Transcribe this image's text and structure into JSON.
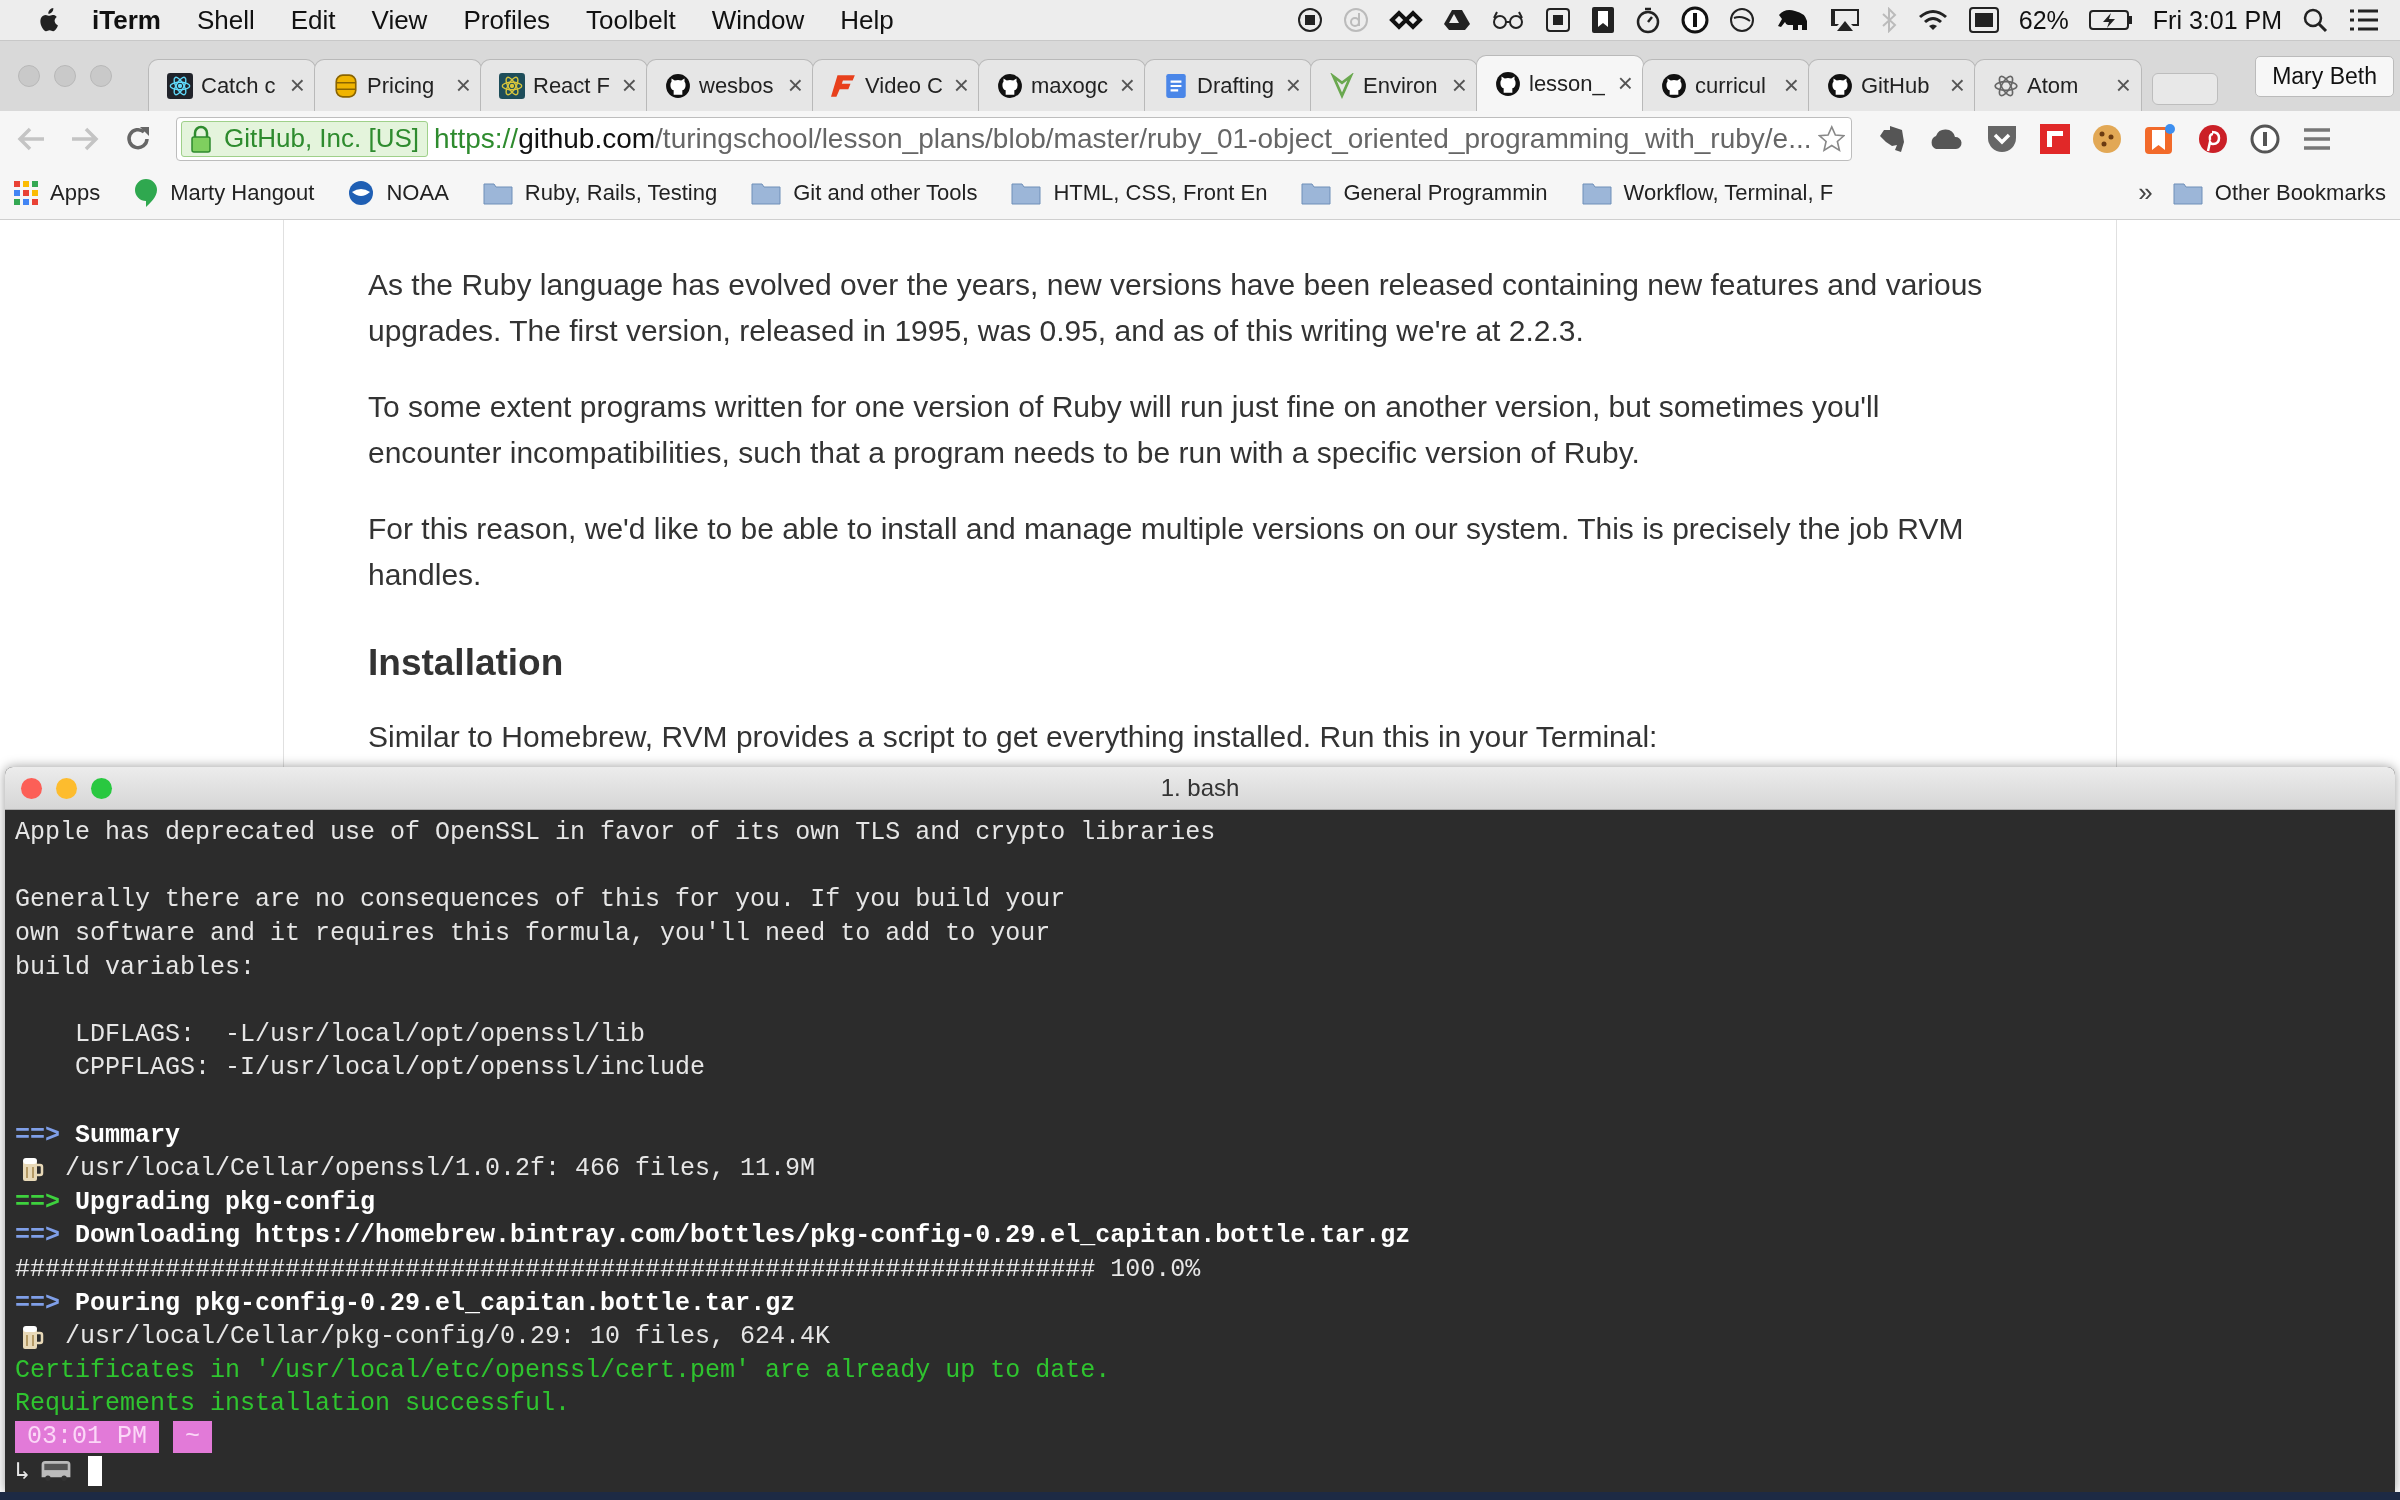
{
  "menubar": {
    "app": "iTerm",
    "menus": [
      "Shell",
      "Edit",
      "View",
      "Profiles",
      "Toolbelt",
      "Window",
      "Help"
    ],
    "battery": "62%",
    "clock": "Fri 3:01 PM"
  },
  "browser": {
    "tabs": [
      {
        "label": "Catch c",
        "selected": false
      },
      {
        "label": "Pricing",
        "selected": false
      },
      {
        "label": "React F",
        "selected": false
      },
      {
        "label": "wesbos",
        "selected": false
      },
      {
        "label": "Video C",
        "selected": false
      },
      {
        "label": "maxogc",
        "selected": false
      },
      {
        "label": "Drafting",
        "selected": false
      },
      {
        "label": "Environ",
        "selected": false
      },
      {
        "label": "lesson_",
        "selected": true
      },
      {
        "label": "curricul",
        "selected": false
      },
      {
        "label": "GitHub",
        "selected": false
      },
      {
        "label": "Atom",
        "selected": false
      }
    ],
    "tab_close": "×",
    "profile": "Mary Beth",
    "address": {
      "identity": "GitHub, Inc. [US]",
      "scheme": "https://",
      "host": "github.com",
      "path": "/turingschool/lesson_plans/blob/master/ruby_01-object_oriented_programming_with_ruby/e..."
    },
    "bookmarks": [
      {
        "kind": "apps",
        "label": "Apps"
      },
      {
        "kind": "hangout",
        "label": "Marty Hangout"
      },
      {
        "kind": "noaa",
        "label": "NOAA"
      },
      {
        "kind": "folder",
        "label": "Ruby, Rails, Testing"
      },
      {
        "kind": "folder",
        "label": "Git and other Tools"
      },
      {
        "kind": "folder",
        "label": "HTML, CSS, Front En"
      },
      {
        "kind": "folder",
        "label": "General Programmin"
      },
      {
        "kind": "folder",
        "label": "Workflow, Terminal, F"
      }
    ],
    "bookmarks_more": "»",
    "other_bookmarks": "Other Bookmarks"
  },
  "page": [
    {
      "kind": "paragraph",
      "text": "As the Ruby language has evolved over the years, new versions have been released containing new features and various upgrades. The first version, released in 1995, was 0.95, and as of this writing we're at 2.2.3."
    },
    {
      "kind": "paragraph",
      "text": "To some extent programs written for one version of Ruby will run just fine on another version, but sometimes you'll encounter incompatibilities, such that a program needs to be run with a specific version of Ruby."
    },
    {
      "kind": "paragraph",
      "text": "For this reason, we'd like to be able to install and manage multiple versions on our system. This is precisely the job RVM handles."
    },
    {
      "kind": "heading",
      "text": "Installation"
    },
    {
      "kind": "paragraph",
      "text": "Similar to Homebrew, RVM provides a script to get everything installed. Run this in your Terminal:"
    }
  ],
  "terminal": {
    "title": "1. bash",
    "lines": [
      {
        "kind": "plain",
        "text": "Apple has deprecated use of OpenSSL in favor of its own TLS and crypto libraries"
      },
      {
        "kind": "blank"
      },
      {
        "kind": "plain",
        "text": "Generally there are no consequences of this for you. If you build your"
      },
      {
        "kind": "plain",
        "text": "own software and it requires this formula, you'll need to add to your"
      },
      {
        "kind": "plain",
        "text": "build variables:"
      },
      {
        "kind": "blank"
      },
      {
        "kind": "plain",
        "text": "    LDFLAGS:  -L/usr/local/opt/openssl/lib"
      },
      {
        "kind": "plain",
        "text": "    CPPFLAGS: -I/usr/local/opt/openssl/include"
      },
      {
        "kind": "blank"
      },
      {
        "kind": "step",
        "marker": "==>",
        "color": "#7f9fe8",
        "text": "Summary"
      },
      {
        "kind": "beer",
        "text": "/usr/local/Cellar/openssl/1.0.2f: 466 files, 11.9M"
      },
      {
        "kind": "step",
        "marker": "==>",
        "color": "#3ed13e",
        "text": "Upgrading pkg-config"
      },
      {
        "kind": "step",
        "marker": "==>",
        "color": "#7f9fe8",
        "text": "Downloading https://homebrew.bintray.com/bottles/pkg-config-0.29.el_capitan.bottle.tar.gz"
      },
      {
        "kind": "plain",
        "text": "######################################################################## 100.0%"
      },
      {
        "kind": "step",
        "marker": "==>",
        "color": "#7f9fe8",
        "text": "Pouring pkg-config-0.29.el_capitan.bottle.tar.gz"
      },
      {
        "kind": "beer",
        "text": "/usr/local/Cellar/pkg-config/0.29: 10 files, 624.4K"
      },
      {
        "kind": "success",
        "text": "Certificates in '/usr/local/etc/openssl/cert.pem' are already up to date."
      },
      {
        "kind": "success",
        "text": "Requirements installation successful."
      },
      {
        "kind": "prompt",
        "time": "03:01 PM",
        "dir": "~"
      },
      {
        "kind": "input",
        "arrow": "↳"
      }
    ]
  }
}
